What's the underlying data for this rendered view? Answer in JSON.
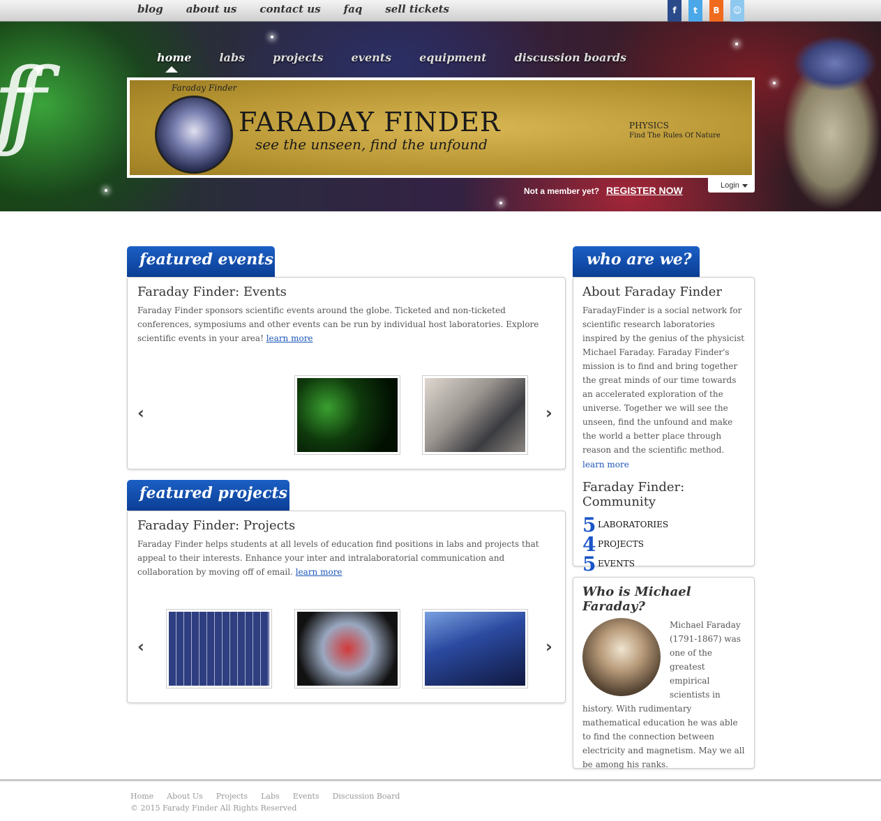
{
  "top_nav": [
    "blog",
    "about us",
    "contact us",
    "faq",
    "sell tickets"
  ],
  "social_icons": [
    "facebook-icon",
    "twitter-icon",
    "blogger-icon",
    "reddit-icon"
  ],
  "main_nav": {
    "items": [
      "home",
      "labs",
      "projects",
      "events",
      "equipment",
      "discussion boards"
    ],
    "active": "home"
  },
  "banner": {
    "medallion_text": "Faraday Finder",
    "title": "FARADAY FINDER",
    "tagline": "see the unseen,  find the unfound",
    "subject": "PHYSICS",
    "subject_tagline": "Find The Rules Of Nature"
  },
  "account": {
    "not_member": "Not a member yet?",
    "register": "REGISTER NOW",
    "login": "Login"
  },
  "featured_events": {
    "tab": "featured events",
    "heading": "Faraday Finder: Events",
    "text": "Faraday Finder sponsors scientific events around the globe. Ticketed and non-ticketed conferences, symposiums and other events can be run by individual host laboratories. Explore scientific events in your area!",
    "learn_more": "learn more"
  },
  "featured_projects": {
    "tab": "featured projects",
    "heading": "Faraday Finder: Projects",
    "text": "Faraday Finder helps students at all levels of education find positions in labs and projects that appeal to their interests. Enhance your inter and intralaboratorial communication and collaboration by moving off of email.",
    "learn_more": "learn more"
  },
  "who_are_we": {
    "tab": "who are we?",
    "heading": "About Faraday Finder",
    "text": "FaradayFinder is a social network for scientific research laboratories inspired by the genius of the physicist Michael Faraday. Faraday Finder's mission is to find and bring together the great minds of our time towards an accelerated exploration of the universe. Together we will see the unseen, find the unfound and make the world a better place through reason and the scientific method.",
    "learn_more": "learn more",
    "community_heading": "Faraday Finder: Community",
    "community": [
      {
        "num": "5",
        "label": "LABORATORIES"
      },
      {
        "num": "4",
        "label": "PROJECTS"
      },
      {
        "num": "5",
        "label": "EVENTS"
      }
    ]
  },
  "who_is_faraday": {
    "heading": "Who is Michael Faraday?",
    "text": "Michael Faraday (1791-1867) was one of the greatest empirical scientists in history. With rudimentary mathematical education he was able to find the connection between electricity and magnetism. May we all be among his ranks."
  },
  "footer": {
    "links": [
      "Home",
      "About Us",
      "Projects",
      "Labs",
      "Events",
      "Discussion Board"
    ],
    "copyright": "© 2015 Farady Finder All Rights Reserved"
  },
  "colors": {
    "tab_blue": "#0b3e95",
    "link_blue": "#1a55b8",
    "banner_gold": "#c9a640"
  }
}
